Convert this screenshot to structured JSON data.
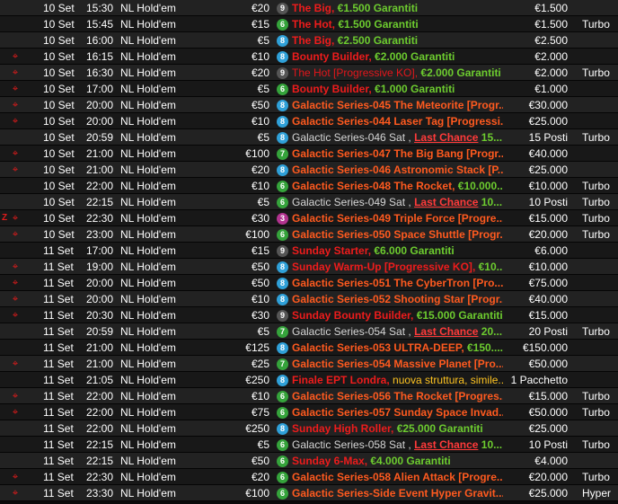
{
  "colors": {
    "badge": {
      "6": "#35a33b",
      "7": "#35a33b",
      "8": "#2fa0d8",
      "9": "#555555",
      "3": "#b2338f"
    },
    "ko_icon": "#e01b1b",
    "prize_green": "#6dcc2f",
    "galactic_orange": "#ff5a1f"
  },
  "icons": {
    "ko": "crosshair-icon",
    "zoom": "z-icon"
  },
  "rows": [
    {
      "ko": false,
      "z": false,
      "date": "10 Set",
      "time": "15:30",
      "game": "NL Hold'em",
      "buyin": "€20",
      "badge": "9",
      "style": "red",
      "parts": [
        {
          "t": "The Big",
          "c": "name"
        },
        {
          "t": ", ",
          "c": "plain"
        },
        {
          "t": "€1.500 Garantiti",
          "c": "green"
        }
      ],
      "prize": "€1.500",
      "type": ""
    },
    {
      "ko": false,
      "z": false,
      "date": "10 Set",
      "time": "15:45",
      "game": "NL Hold'em",
      "buyin": "€15",
      "badge": "6",
      "style": "red",
      "parts": [
        {
          "t": "The Hot",
          "c": "name"
        },
        {
          "t": ", ",
          "c": "plain"
        },
        {
          "t": "€1.500 Garantiti",
          "c": "green"
        }
      ],
      "prize": "€1.500",
      "type": "Turbo"
    },
    {
      "ko": false,
      "z": false,
      "date": "10 Set",
      "time": "16:00",
      "game": "NL Hold'em",
      "buyin": "€5",
      "badge": "8",
      "style": "red",
      "parts": [
        {
          "t": "The Big",
          "c": "name"
        },
        {
          "t": ", ",
          "c": "plain"
        },
        {
          "t": "€2.500 Garantiti",
          "c": "green"
        }
      ],
      "prize": "€2.500",
      "type": ""
    },
    {
      "ko": true,
      "z": false,
      "date": "10 Set",
      "time": "16:15",
      "game": "NL Hold'em",
      "buyin": "€10",
      "badge": "8",
      "style": "red",
      "parts": [
        {
          "t": "Bounty Builder",
          "c": "name"
        },
        {
          "t": ", ",
          "c": "plain"
        },
        {
          "t": "€2.000 Garantiti",
          "c": "green"
        }
      ],
      "prize": "€2.000",
      "type": ""
    },
    {
      "ko": true,
      "z": false,
      "date": "10 Set",
      "time": "16:30",
      "game": "NL Hold'em",
      "buyin": "€20",
      "badge": "9",
      "style": "red2",
      "parts": [
        {
          "t": "The Hot [Progressive KO]",
          "c": "name"
        },
        {
          "t": ", ",
          "c": "plain"
        },
        {
          "t": "€2.000 Garantiti",
          "c": "green"
        }
      ],
      "prize": "€2.000",
      "type": "Turbo"
    },
    {
      "ko": true,
      "z": false,
      "date": "10 Set",
      "time": "17:00",
      "game": "NL Hold'em",
      "buyin": "€5",
      "badge": "6",
      "style": "red",
      "parts": [
        {
          "t": "Bounty Builder",
          "c": "name"
        },
        {
          "t": ", ",
          "c": "plain"
        },
        {
          "t": "€1.000 Garantiti",
          "c": "green"
        }
      ],
      "prize": "€1.000",
      "type": ""
    },
    {
      "ko": true,
      "z": false,
      "date": "10 Set",
      "time": "20:00",
      "game": "NL Hold'em",
      "buyin": "€50",
      "badge": "8",
      "style": "orange",
      "parts": [
        {
          "t": "Galactic Series-045 The Meteorite [Progr...",
          "c": "name"
        }
      ],
      "prize": "€30.000",
      "type": ""
    },
    {
      "ko": true,
      "z": false,
      "date": "10 Set",
      "time": "20:00",
      "game": "NL Hold'em",
      "buyin": "€10",
      "badge": "8",
      "style": "orange",
      "parts": [
        {
          "t": "Galactic Series-044 Laser Tag [Progressi...",
          "c": "name"
        }
      ],
      "prize": "€25.000",
      "type": ""
    },
    {
      "ko": false,
      "z": false,
      "date": "10 Set",
      "time": "20:59",
      "game": "NL Hold'em",
      "buyin": "€5",
      "badge": "8",
      "style": "grey",
      "parts": [
        {
          "t": "Galactic Series-046 Sat",
          "c": "name"
        },
        {
          "t": " , ",
          "c": "plain"
        },
        {
          "t": "Last Chance",
          "c": "lc"
        },
        {
          "t": " 15...",
          "c": "green"
        }
      ],
      "prize": "15 Posti",
      "type": "Turbo"
    },
    {
      "ko": true,
      "z": false,
      "date": "10 Set",
      "time": "21:00",
      "game": "NL Hold'em",
      "buyin": "€100",
      "badge": "7",
      "style": "orange",
      "parts": [
        {
          "t": "Galactic Series-047 The Big Bang [Progr...",
          "c": "name"
        }
      ],
      "prize": "€40.000",
      "type": ""
    },
    {
      "ko": true,
      "z": false,
      "date": "10 Set",
      "time": "21:00",
      "game": "NL Hold'em",
      "buyin": "€20",
      "badge": "8",
      "style": "orange",
      "parts": [
        {
          "t": "Galactic Series-046 Astronomic Stack [P...",
          "c": "name"
        }
      ],
      "prize": "€25.000",
      "type": ""
    },
    {
      "ko": false,
      "z": false,
      "date": "10 Set",
      "time": "22:00",
      "game": "NL Hold'em",
      "buyin": "€10",
      "badge": "6",
      "style": "orange",
      "parts": [
        {
          "t": "Galactic Series-048 The Rocket",
          "c": "name"
        },
        {
          "t": ", ",
          "c": "plain"
        },
        {
          "t": "€10.000...",
          "c": "green"
        }
      ],
      "prize": "€10.000",
      "type": "Turbo"
    },
    {
      "ko": false,
      "z": false,
      "date": "10 Set",
      "time": "22:15",
      "game": "NL Hold'em",
      "buyin": "€5",
      "badge": "6",
      "style": "grey",
      "parts": [
        {
          "t": "Galactic Series-049 Sat",
          "c": "name"
        },
        {
          "t": " , ",
          "c": "plain"
        },
        {
          "t": "Last Chance",
          "c": "lc"
        },
        {
          "t": " 10...",
          "c": "green"
        }
      ],
      "prize": "10 Posti",
      "type": "Turbo"
    },
    {
      "ko": true,
      "z": true,
      "date": "10 Set",
      "time": "22:30",
      "game": "NL Hold'em",
      "buyin": "€30",
      "badge": "3",
      "style": "orange",
      "parts": [
        {
          "t": "Galactic Series-049 Triple Force [Progre...",
          "c": "name"
        }
      ],
      "prize": "€15.000",
      "type": "Turbo"
    },
    {
      "ko": true,
      "z": false,
      "date": "10 Set",
      "time": "23:00",
      "game": "NL Hold'em",
      "buyin": "€100",
      "badge": "6",
      "style": "orange",
      "parts": [
        {
          "t": "Galactic Series-050 Space Shuttle [Progr...",
          "c": "name"
        }
      ],
      "prize": "€20.000",
      "type": "Turbo"
    },
    {
      "ko": false,
      "z": false,
      "date": "11 Set",
      "time": "17:00",
      "game": "NL Hold'em",
      "buyin": "€15",
      "badge": "9",
      "style": "red",
      "parts": [
        {
          "t": "Sunday Starter",
          "c": "name"
        },
        {
          "t": ", ",
          "c": "plain"
        },
        {
          "t": "€6.000 Garantiti",
          "c": "green"
        }
      ],
      "prize": "€6.000",
      "type": ""
    },
    {
      "ko": true,
      "z": false,
      "date": "11 Set",
      "time": "19:00",
      "game": "NL Hold'em",
      "buyin": "€50",
      "badge": "8",
      "style": "red",
      "parts": [
        {
          "t": "Sunday Warm-Up [Progressive KO]",
          "c": "name"
        },
        {
          "t": ", ",
          "c": "plain"
        },
        {
          "t": "€10...",
          "c": "green"
        }
      ],
      "prize": "€10.000",
      "type": ""
    },
    {
      "ko": true,
      "z": false,
      "date": "11 Set",
      "time": "20:00",
      "game": "NL Hold'em",
      "buyin": "€50",
      "badge": "8",
      "style": "orange",
      "parts": [
        {
          "t": "Galactic Series-051 The CyberTron [Pro...",
          "c": "name"
        }
      ],
      "prize": "€75.000",
      "type": ""
    },
    {
      "ko": true,
      "z": false,
      "date": "11 Set",
      "time": "20:00",
      "game": "NL Hold'em",
      "buyin": "€10",
      "badge": "8",
      "style": "orange",
      "parts": [
        {
          "t": "Galactic Series-052 Shooting Star [Progr...",
          "c": "name"
        }
      ],
      "prize": "€40.000",
      "type": ""
    },
    {
      "ko": true,
      "z": false,
      "date": "11 Set",
      "time": "20:30",
      "game": "NL Hold'em",
      "buyin": "€30",
      "badge": "9",
      "style": "red",
      "parts": [
        {
          "t": "Sunday Bounty Builder",
          "c": "name"
        },
        {
          "t": ", ",
          "c": "plain"
        },
        {
          "t": "€15.000 Garantiti",
          "c": "green"
        }
      ],
      "prize": "€15.000",
      "type": ""
    },
    {
      "ko": false,
      "z": false,
      "date": "11 Set",
      "time": "20:59",
      "game": "NL Hold'em",
      "buyin": "€5",
      "badge": "7",
      "style": "grey",
      "parts": [
        {
          "t": "Galactic Series-054 Sat",
          "c": "name"
        },
        {
          "t": " , ",
          "c": "plain"
        },
        {
          "t": "Last Chance",
          "c": "lc"
        },
        {
          "t": " 20...",
          "c": "green"
        }
      ],
      "prize": "20 Posti",
      "type": "Turbo"
    },
    {
      "ko": false,
      "z": false,
      "date": "11 Set",
      "time": "21:00",
      "game": "NL Hold'em",
      "buyin": "€125",
      "badge": "8",
      "style": "orange",
      "parts": [
        {
          "t": "Galactic Series-053 ULTRA-DEEP",
          "c": "name"
        },
        {
          "t": ", ",
          "c": "plain"
        },
        {
          "t": "€150....",
          "c": "green"
        }
      ],
      "prize": "€150.000",
      "type": ""
    },
    {
      "ko": true,
      "z": false,
      "date": "11 Set",
      "time": "21:00",
      "game": "NL Hold'em",
      "buyin": "€25",
      "badge": "7",
      "style": "orange",
      "parts": [
        {
          "t": "Galactic Series-054 Massive Planet [Pro...",
          "c": "name"
        }
      ],
      "prize": "€50.000",
      "type": ""
    },
    {
      "ko": false,
      "z": false,
      "date": "11 Set",
      "time": "21:05",
      "game": "NL Hold'em",
      "buyin": "€250",
      "badge": "8",
      "style": "red",
      "parts": [
        {
          "t": "Finale EPT Londra",
          "c": "name"
        },
        {
          "t": ", ",
          "c": "plain"
        },
        {
          "t": "nuova struttura, simile...",
          "c": "nv"
        }
      ],
      "prize": "1 Pacchetto",
      "type": ""
    },
    {
      "ko": true,
      "z": false,
      "date": "11 Set",
      "time": "22:00",
      "game": "NL Hold'em",
      "buyin": "€10",
      "badge": "6",
      "style": "orange",
      "parts": [
        {
          "t": "Galactic Series-056 The Rocket [Progres...",
          "c": "name"
        }
      ],
      "prize": "€15.000",
      "type": "Turbo"
    },
    {
      "ko": true,
      "z": false,
      "date": "11 Set",
      "time": "22:00",
      "game": "NL Hold'em",
      "buyin": "€75",
      "badge": "6",
      "style": "orange",
      "parts": [
        {
          "t": "Galactic Series-057 Sunday Space Invad...",
          "c": "name"
        }
      ],
      "prize": "€50.000",
      "type": "Turbo"
    },
    {
      "ko": false,
      "z": false,
      "date": "11 Set",
      "time": "22:00",
      "game": "NL Hold'em",
      "buyin": "€250",
      "badge": "8",
      "style": "red",
      "parts": [
        {
          "t": "Sunday High Roller",
          "c": "name"
        },
        {
          "t": ", ",
          "c": "plain"
        },
        {
          "t": "€25.000 Garantiti",
          "c": "green"
        }
      ],
      "prize": "€25.000",
      "type": ""
    },
    {
      "ko": false,
      "z": false,
      "date": "11 Set",
      "time": "22:15",
      "game": "NL Hold'em",
      "buyin": "€5",
      "badge": "6",
      "style": "grey",
      "parts": [
        {
          "t": "Galactic Series-058 Sat",
          "c": "name"
        },
        {
          "t": " , ",
          "c": "plain"
        },
        {
          "t": "Last Chance",
          "c": "lc"
        },
        {
          "t": " 10...",
          "c": "green"
        }
      ],
      "prize": "10 Posti",
      "type": "Turbo"
    },
    {
      "ko": false,
      "z": false,
      "date": "11 Set",
      "time": "22:15",
      "game": "NL Hold'em",
      "buyin": "€50",
      "badge": "6",
      "style": "red",
      "parts": [
        {
          "t": "Sunday 6-Max",
          "c": "name"
        },
        {
          "t": ", ",
          "c": "plain"
        },
        {
          "t": "€4.000 Garantiti",
          "c": "green"
        }
      ],
      "prize": "€4.000",
      "type": ""
    },
    {
      "ko": true,
      "z": false,
      "date": "11 Set",
      "time": "22:30",
      "game": "NL Hold'em",
      "buyin": "€20",
      "badge": "6",
      "style": "orange",
      "parts": [
        {
          "t": "Galactic Series-058 Alien Attack [Progre...",
          "c": "name"
        }
      ],
      "prize": "€20.000",
      "type": "Turbo"
    },
    {
      "ko": true,
      "z": false,
      "date": "11 Set",
      "time": "23:30",
      "game": "NL Hold'em",
      "buyin": "€100",
      "badge": "6",
      "style": "orange",
      "parts": [
        {
          "t": "Galactic Series-Side Event Hyper Gravit...",
          "c": "name"
        }
      ],
      "prize": "€25.000",
      "type": "Hyper"
    }
  ]
}
